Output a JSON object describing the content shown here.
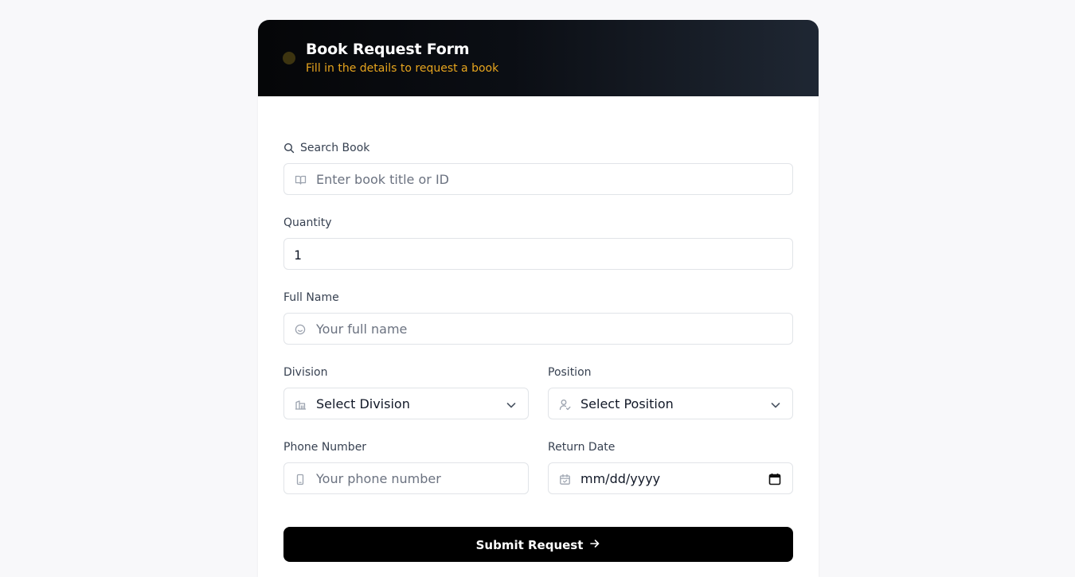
{
  "header": {
    "title": "Book Request Form",
    "subtitle": "Fill in the details to request a book"
  },
  "form": {
    "search_book": {
      "label": "Search Book",
      "placeholder": "Enter book title or ID"
    },
    "quantity": {
      "label": "Quantity",
      "value": "1"
    },
    "full_name": {
      "label": "Full Name",
      "placeholder": "Your full name"
    },
    "division": {
      "label": "Division",
      "selected": "Select Division"
    },
    "position": {
      "label": "Position",
      "selected": "Select Position"
    },
    "phone": {
      "label": "Phone Number",
      "placeholder": "Your phone number"
    },
    "return_date": {
      "label": "Return Date",
      "placeholder": "mm/dd/yyyy"
    },
    "submit_label": "Submit Request"
  },
  "icons": {
    "header": "status-dot",
    "search": "search-icon",
    "book": "book-icon",
    "user": "user-circle-icon",
    "division": "building-icon",
    "position": "user-check-icon",
    "phone": "phone-icon",
    "calendar": "calendar-icon",
    "arrow": "arrow-right-icon"
  },
  "colors": {
    "accent": "#e7a51e",
    "header_bg": "#0b0e14",
    "button_bg": "#000000"
  }
}
